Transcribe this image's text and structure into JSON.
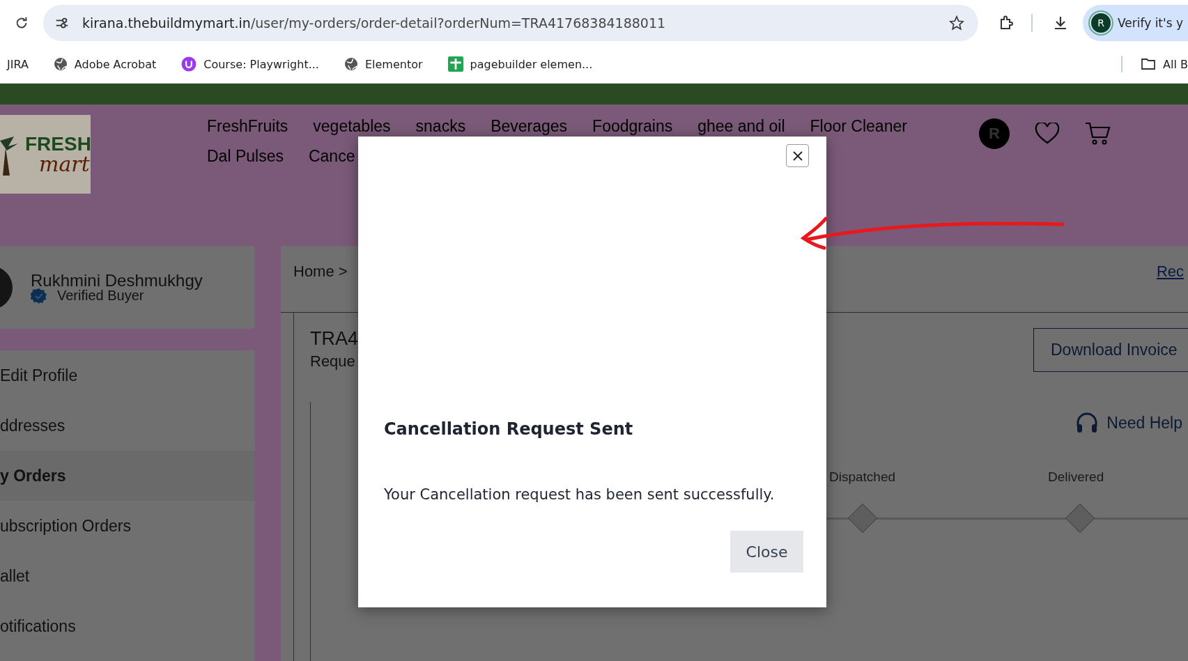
{
  "browser": {
    "url_host": "kirana.thebuildmymart.in",
    "url_path": "/user/my-orders/order-detail?orderNum=TRA41768384188011",
    "profile_button": "Verify it's y",
    "profile_initial": "R",
    "bookmarks": [
      {
        "label": "JIRA",
        "kind": "plain"
      },
      {
        "label": "Adobe Acrobat",
        "kind": "globe"
      },
      {
        "label": "Course: Playwright...",
        "kind": "course"
      },
      {
        "label": "Elementor",
        "kind": "globe"
      },
      {
        "label": "pagebuilder elemen...",
        "kind": "sheet"
      }
    ],
    "all_bookmarks": "All B"
  },
  "site": {
    "logo": {
      "line1": "FRESH",
      "line2": "mart"
    },
    "nav": [
      "FreshFruits",
      "vegetables",
      "snacks",
      "Beverages",
      "Foodgrains",
      "ghee and oil",
      "Floor Cleaner",
      "Dal Pulses",
      "Cance"
    ],
    "avatar_initial": "R"
  },
  "profile": {
    "name": "Rukhmini Deshmukhgy",
    "status": "Verified Buyer"
  },
  "sidebar": {
    "items": [
      {
        "label": "Edit Profile",
        "selected": false
      },
      {
        "label": "ddresses",
        "selected": false
      },
      {
        "label": "y Orders",
        "selected": true
      },
      {
        "label": "ubscription Orders",
        "selected": false
      },
      {
        "label": "allet",
        "selected": false
      },
      {
        "label": "otifications",
        "selected": false
      }
    ]
  },
  "breadcrumb": "Home >",
  "corner_link": "Rec",
  "order": {
    "number": "TRA4",
    "status": "Reque"
  },
  "download_button": "Download Invoice",
  "help_link": "Need Help",
  "steps": [
    {
      "label": "Dispatched"
    },
    {
      "label": "Delivered"
    }
  ],
  "modal": {
    "title": "Cancellation Request Sent",
    "message": "Your Cancellation request has been sent successfully.",
    "close_button": "Close"
  }
}
